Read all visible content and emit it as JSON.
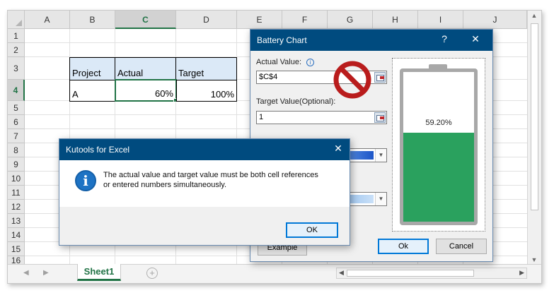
{
  "grid": {
    "columns": [
      "A",
      "B",
      "C",
      "D",
      "E",
      "F",
      "G",
      "H",
      "I",
      "J"
    ],
    "rows": [
      "1",
      "2",
      "3",
      "4",
      "5",
      "6",
      "7",
      "8",
      "9",
      "10",
      "11",
      "12",
      "13",
      "14",
      "15",
      "16"
    ],
    "selected_column": "C",
    "selected_row": "4"
  },
  "table": {
    "headers": [
      "Project",
      "Actual",
      "Target"
    ],
    "row": [
      "A",
      "60%",
      "100%"
    ]
  },
  "sheet_tab": "Sheet1",
  "battery_dialog": {
    "title": "Battery Chart",
    "help": "?",
    "close": "✕",
    "actual_label": "Actual Value:",
    "info_glyph": "i",
    "actual_value": "$C$4",
    "target_label": "Target Value(Optional):",
    "target_value": "1",
    "example_button": "Example",
    "ok_button": "Ok",
    "cancel_button": "Cancel",
    "preview": {
      "percent_label": "59.20%",
      "fill_fraction": 0.592,
      "fill_color": "#2aa15e",
      "frame_color": "#a8a8a8"
    }
  },
  "message_box": {
    "title": "Kutools for Excel",
    "close": "✕",
    "icon": "info-icon",
    "icon_glyph": "i",
    "message_line1": "The actual value and target value must be both cell references",
    "message_line2": "or entered numbers simultaneously.",
    "ok_button": "OK"
  },
  "overlay": {
    "icon": "forbidden-icon",
    "color": "#b91c1c"
  },
  "colors": {
    "excel_green": "#217346",
    "dialog_title": "#004b7f",
    "header_fill": "#dbe9f7"
  }
}
